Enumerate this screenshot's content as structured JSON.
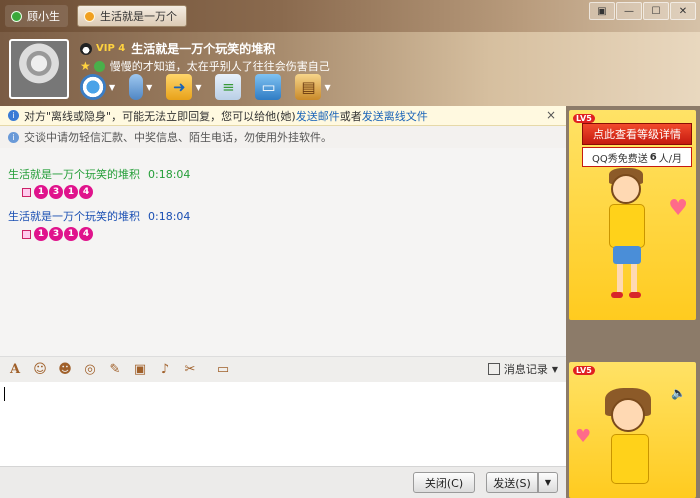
{
  "window": {
    "tabs": [
      {
        "label": "顾小生"
      },
      {
        "label": "生活就是一万个"
      }
    ],
    "controls": {
      "restore": "▣",
      "minimize": "—",
      "maximize": "☐",
      "close": "✕"
    }
  },
  "contact": {
    "vip_badge": "VIP 4",
    "name": "生活就是一万个玩笑的堆积",
    "signature": "慢慢的才知道，太在乎别人了往往会伤害自己"
  },
  "toolbar_icons": [
    "video-call-icon",
    "voice-call-icon",
    "file-transfer-icon",
    "sms-icon",
    "remote-desktop-icon",
    "apps-icon"
  ],
  "notice": {
    "text_prefix": "对方\"离线或隐身\"，可能无法立即回复，您可以给他(她)",
    "link_email": "发送邮件",
    "or": "或者",
    "link_offline_file": "发送离线文件",
    "close": "×"
  },
  "security_notice": "交谈中请勿轻信汇款、中奖信息、陌生电话，勿使用外挂软件。",
  "messages": [
    {
      "sender": "生活就是一万个玩笑的堆积",
      "time": "0:18:04",
      "digits": [
        "1",
        "3",
        "1",
        "4"
      ],
      "color": "#249e38"
    },
    {
      "sender": "生活就是一万个玩笑的堆积",
      "time": "0:18:04",
      "digits": [
        "1",
        "3",
        "1",
        "4"
      ],
      "color": "#1a4fb3"
    }
  ],
  "input_toolbar": {
    "icons": [
      "font-icon",
      "emoji-icon",
      "magic-face-icon",
      "shake-icon",
      "edit-icon",
      "image-icon",
      "music-icon",
      "screenshot-icon",
      "wallet-icon"
    ],
    "history_label": "消息记录"
  },
  "buttons": {
    "close": "关闭(C)",
    "send": "发送(S)"
  },
  "side_panel": {
    "level_badge": "LV5",
    "upgrade": "点此查看等级详情",
    "free_prefix": "QQ秀免费送",
    "free_num": "6",
    "free_suffix": "人/月",
    "level_badge2": "LV5"
  }
}
